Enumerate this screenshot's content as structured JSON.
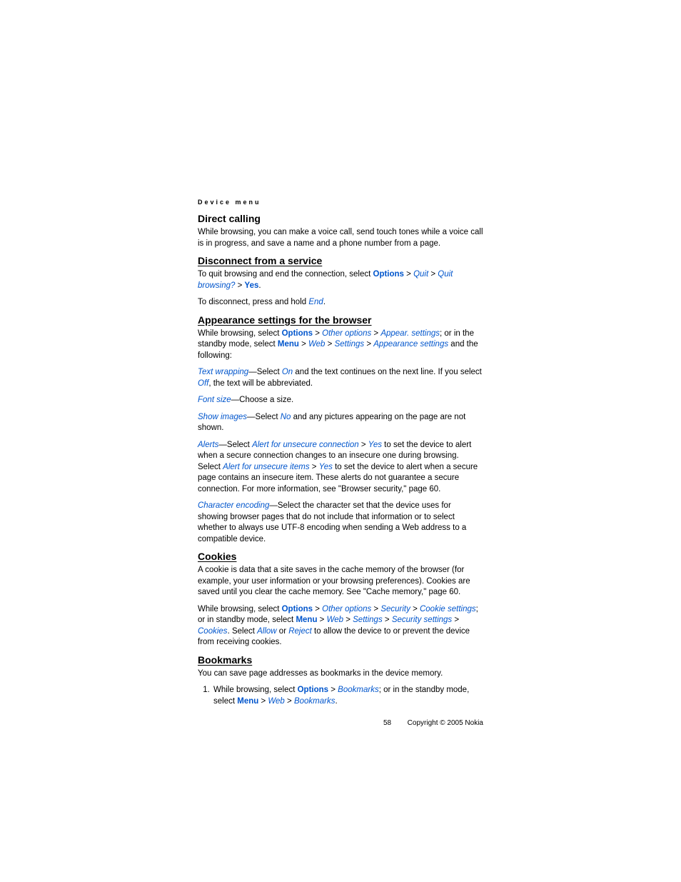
{
  "header": {
    "label": "Device menu"
  },
  "sections": {
    "directCalling": {
      "title": "Direct calling",
      "body": "While browsing, you can make a voice call, send touch tones while a voice call is in progress, and save a name and a phone number from a page."
    },
    "disconnect": {
      "title": "Disconnect from a service",
      "para1_a": "To quit browsing and end the connection, select ",
      "options": "Options",
      "gt": " > ",
      "quit": "Quit",
      "quitBrowsing": "Quit browsing?",
      "yes": "Yes",
      "period": ".",
      "para2_a": "To disconnect, press and hold ",
      "end": "End"
    },
    "appearance": {
      "title": "Appearance settings for the browser",
      "p1_a": "While browsing, select ",
      "options": "Options",
      "gt": " > ",
      "otherOptions": "Other options",
      "appearSettings": "Appear. settings",
      "p1_b": "; or in the standby mode, select ",
      "menu": "Menu",
      "web": "Web",
      "settings": "Settings",
      "appearanceSettings": "Appearance settings",
      "p1_c": " and the following:",
      "textWrapping": "Text wrapping",
      "p2_a": "—Select ",
      "on": "On",
      "p2_b": " and the text continues on the next line. If you select ",
      "off": "Off",
      "p2_c": ", the text will be abbreviated.",
      "fontSize": "Font size",
      "p3_a": "—Choose a size.",
      "showImages": "Show images",
      "p4_a": "—Select ",
      "no": "No",
      "p4_b": " and any pictures appearing on the page are not shown.",
      "alerts": "Alerts",
      "p5_a": "—Select ",
      "alertUnsecureConn": "Alert for unsecure connection",
      "yes2": "Yes",
      "p5_b": " to set the device to alert when a secure connection changes to an insecure one during browsing. Select ",
      "alertUnsecureItems": "Alert for unsecure items",
      "p5_c": " to set the device to alert when a secure page contains an insecure item. These alerts do not guarantee a secure connection. For more information, see \"Browser security,\" page 60.",
      "charEncoding": "Character encoding",
      "p6_a": "—Select the character set that the device uses for showing browser pages that do not include that information or to select whether to always use UTF-8 encoding when sending a Web address to a compatible device."
    },
    "cookies": {
      "title": "Cookies",
      "p1": "A cookie is data that a site saves in the cache memory of the browser (for example, your user information or your browsing preferences). Cookies are saved until you clear the cache memory. See \"Cache memory,\" page 60.",
      "p2_a": "While browsing, select ",
      "options": "Options",
      "gt": " > ",
      "otherOptions": "Other options",
      "security": "Security",
      "cookieSettings": "Cookie settings",
      "p2_b": "; or in standby mode, select ",
      "menu": "Menu",
      "web": "Web",
      "settings": "Settings",
      "securitySettings": "Security settings",
      "cookiesItem": "Cookies",
      "p2_c": ". Select ",
      "allow": "Allow",
      "p2_d": " or ",
      "reject": "Reject",
      "p2_e": " to allow the device to or prevent the device from receiving cookies."
    },
    "bookmarks": {
      "title": "Bookmarks",
      "p1": "You can save page addresses as bookmarks in the device memory.",
      "li1_a": "While browsing, select ",
      "options": "Options",
      "gt": " > ",
      "bookmarks": "Bookmarks",
      "li1_b": "; or in the standby mode, select ",
      "menu": "Menu",
      "web": "Web",
      "period": "."
    }
  },
  "footer": {
    "page": "58",
    "copyright": "Copyright © 2005 Nokia"
  }
}
